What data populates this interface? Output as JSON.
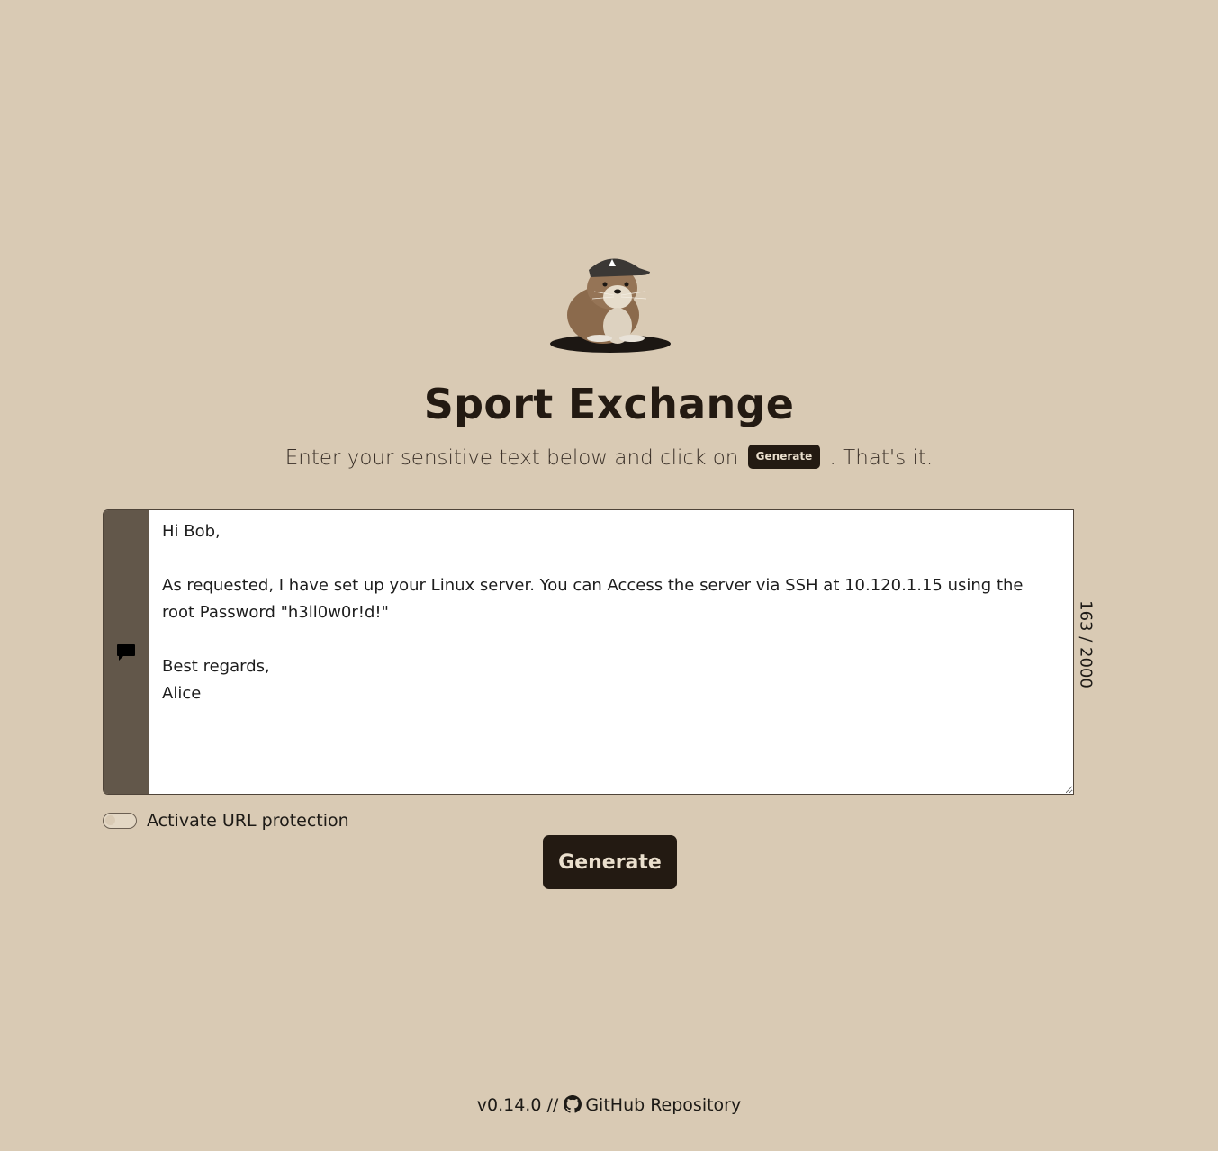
{
  "app": {
    "title": "Sport Exchange",
    "subtitle_before": "Enter your sensitive text below and click on",
    "subtitle_badge": "Generate",
    "subtitle_after": ". That's it."
  },
  "editor": {
    "text": "Hi Bob,\n\nAs requested, I have set up your Linux server. You can Access the server via SSH at 10.120.1.15 using the root Password \"h3ll0w0r!d!\"\n\nBest regards,\nAlice",
    "counter": "163 / 2000",
    "gutter_icon": "message-icon"
  },
  "options": {
    "url_protection_label": "Activate URL protection",
    "url_protection_enabled": false
  },
  "actions": {
    "generate_label": "Generate"
  },
  "footer": {
    "version": "v0.14.0 //",
    "repo_label": "GitHub Repository",
    "repo_icon": "github-icon"
  },
  "colors": {
    "background": "#d9cab4",
    "primary": "#231a12",
    "gutter": "#62574a"
  }
}
